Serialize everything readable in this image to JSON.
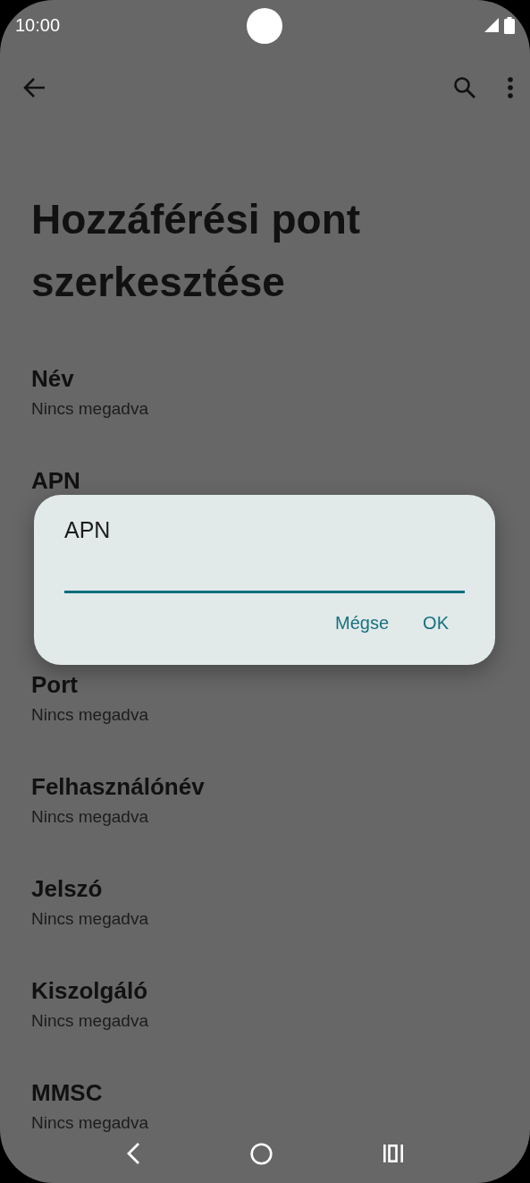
{
  "status_bar": {
    "time": "10:00"
  },
  "title": "Hozzáférési pont szerkesztése",
  "items": [
    {
      "title": "Név",
      "subtitle": "Nincs megadva"
    },
    {
      "title": "APN"
    },
    {
      "title": "Port",
      "subtitle": "Nincs megadva"
    },
    {
      "title": "Felhasználónév",
      "subtitle": "Nincs megadva"
    },
    {
      "title": "Jelszó",
      "subtitle": "Nincs megadva"
    },
    {
      "title": "Kiszolgáló",
      "subtitle": "Nincs megadva"
    },
    {
      "title": "MMSC",
      "subtitle": "Nincs megadva"
    }
  ],
  "dialog": {
    "title": "APN",
    "buttons": [
      "Mégse",
      "OK"
    ]
  }
}
